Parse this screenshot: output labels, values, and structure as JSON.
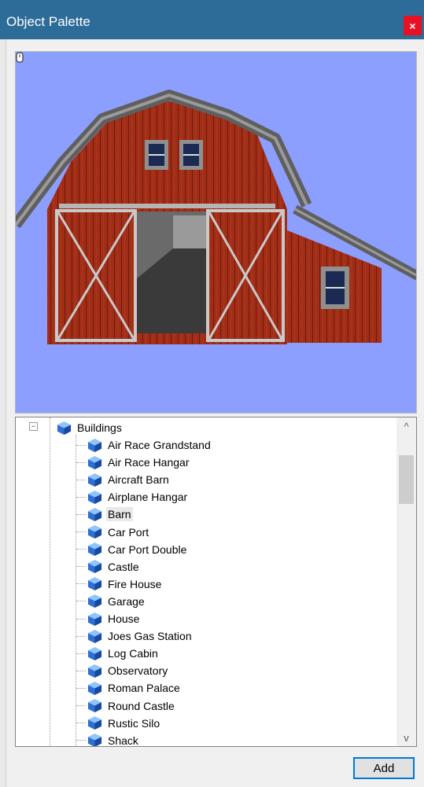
{
  "window": {
    "title": "Object Palette",
    "close_label": "×"
  },
  "tree": {
    "root": {
      "label": "Buildings",
      "expander": "−"
    },
    "items": [
      "Air Race Grandstand",
      "Air Race Hangar",
      "Aircraft Barn",
      "Airplane Hangar",
      "Barn",
      "Car Port",
      "Car Port Double",
      "Castle",
      "Fire House",
      "Garage",
      "House",
      "Joes Gas Station",
      "Log Cabin",
      "Observatory",
      "Roman Palace",
      "Round Castle",
      "Rustic Silo",
      "Shack"
    ],
    "selected": "Barn"
  },
  "scrollbar": {
    "up": "^",
    "down": "v"
  },
  "buttons": {
    "add_label": "Add"
  },
  "colors": {
    "titlebar": "#2d6c98",
    "close": "#e81123",
    "preview_bg": "#8d9ffe",
    "barn_red": "#9c2a17",
    "roof": "#6e6e6e"
  },
  "icons": {
    "tree_item": "blue-cube-icon",
    "preview_handle": "drag-handle-icon"
  }
}
